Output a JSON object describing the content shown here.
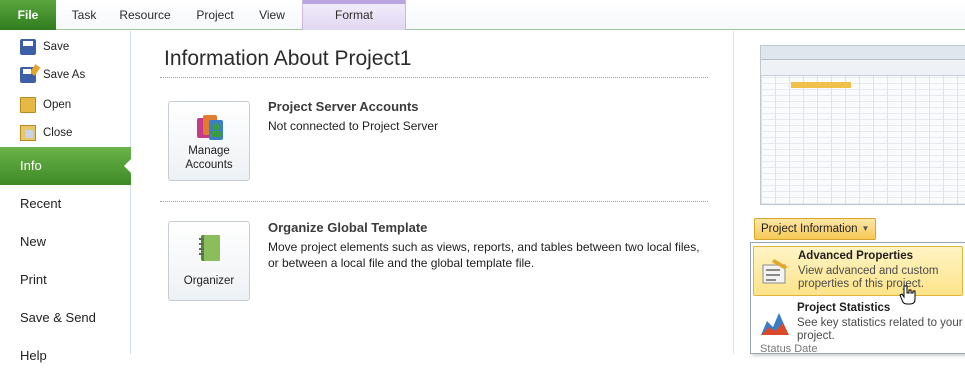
{
  "ribbon": {
    "tabs": [
      "File",
      "Task",
      "Resource",
      "Project",
      "View",
      "Format"
    ]
  },
  "nav": {
    "commands": [
      "Save",
      "Save As",
      "Open",
      "Close"
    ],
    "pages": [
      "Info",
      "Recent",
      "New",
      "Print",
      "Save & Send",
      "Help"
    ],
    "active": "Info"
  },
  "main": {
    "title": "Information About Project1",
    "accounts": {
      "button_label": "Manage Accounts",
      "heading": "Project Server Accounts",
      "text": "Not connected to Project Server"
    },
    "template": {
      "button_label": "Organizer",
      "heading": "Organize Global Template",
      "text": "Move project elements such as views, reports, and tables between two local files, or between a local file and the global template file."
    }
  },
  "right": {
    "dropdown_label": "Project Information",
    "menu": [
      {
        "title": "Advanced Properties",
        "desc": "View advanced and custom properties of this project."
      },
      {
        "title": "Project Statistics",
        "desc": "See key statistics related to your project."
      }
    ],
    "status_peek": "Status Date"
  },
  "colors": {
    "file_tab": "#2f7d1e",
    "active_nav": "#4a9a2e",
    "highlight": "#fde48a"
  }
}
